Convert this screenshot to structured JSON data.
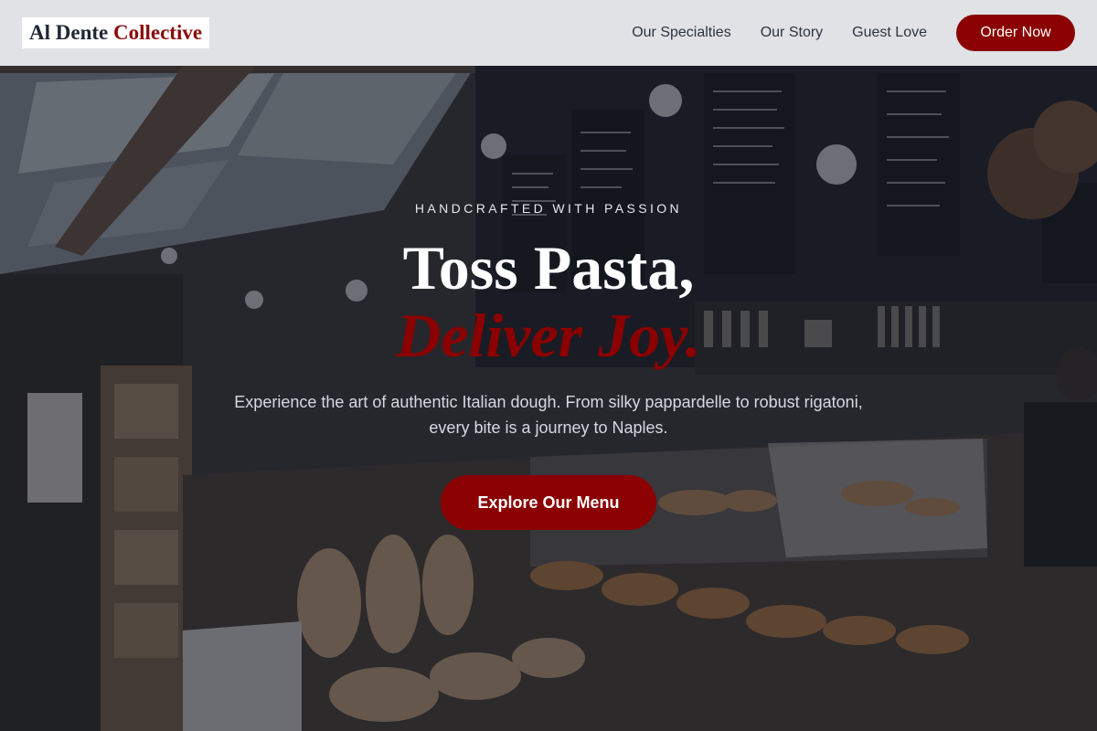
{
  "brand": {
    "name_main": "Al Dente",
    "name_accent": "Collective",
    "accent_color": "#8b0000"
  },
  "nav": {
    "links": [
      "Our Specialties",
      "Our Story",
      "Guest Love"
    ],
    "order_button": "Order Now"
  },
  "hero": {
    "eyebrow": "HANDCRAFTED WITH PASSION",
    "headline_line1": "Toss Pasta,",
    "headline_line2": "Deliver Joy.",
    "description": "Experience the art of authentic Italian dough. From silky pappardelle to robust rigatoni, every bite is a journey to Naples.",
    "cta_button": "Explore Our Menu",
    "background_image": "cafe-bakery-interior-photo"
  }
}
